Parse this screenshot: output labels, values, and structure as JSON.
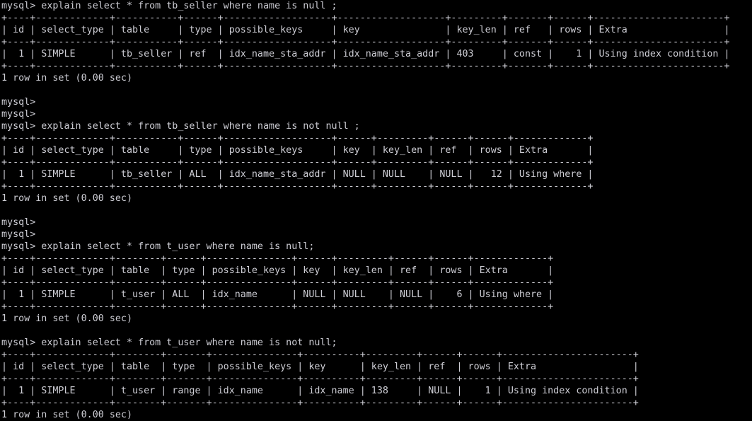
{
  "terminal": {
    "prompt": "mysql>",
    "background_color": "#000000",
    "text_color": "#cdcdd4",
    "font_size_px": 13.2,
    "line_height_px": 17,
    "columns": 132,
    "blocks": [
      {
        "id": "query-1",
        "command": "mysql> explain select * from tb_seller where name is null ;",
        "columns": [
          "id",
          "select_type",
          "table",
          "type",
          "possible_keys",
          "key",
          "key_len",
          "ref",
          "rows",
          "Extra"
        ],
        "rows": [
          {
            "id": "1",
            "select_type": "SIMPLE",
            "table": "tb_seller",
            "type": "ref",
            "possible_keys": "idx_name_sta_addr",
            "key": "idx_name_sta_addr",
            "key_len": "403",
            "ref": "const",
            "rows": "1",
            "Extra": "Using index condition"
          }
        ],
        "status": "1 row in set (0.00 sec)",
        "ascii": [
          "+----+-------------+-----------+------+-------------------+-------------------+---------+-------+------+-----------------------+",
          "| id | select_type | table     | type | possible_keys     | key               | key_len | ref   | rows | Extra                 |",
          "+----+-------------+-----------+------+-------------------+-------------------+---------+-------+------+-----------------------+",
          "|  1 | SIMPLE      | tb_seller | ref  | idx_name_sta_addr | idx_name_sta_addr | 403     | const |    1 | Using index condition |",
          "+----+-------------+-----------+------+-------------------+-------------------+---------+-------+------+-----------------------+"
        ]
      },
      {
        "id": "query-2",
        "command": "mysql> explain select * from tb_seller where name is not null ;",
        "columns": [
          "id",
          "select_type",
          "table",
          "type",
          "possible_keys",
          "key",
          "key_len",
          "ref",
          "rows",
          "Extra"
        ],
        "rows": [
          {
            "id": "1",
            "select_type": "SIMPLE",
            "table": "tb_seller",
            "type": "ALL",
            "possible_keys": "idx_name_sta_addr",
            "key": "NULL",
            "key_len": "NULL",
            "ref": "NULL",
            "rows": "12",
            "Extra": "Using where"
          }
        ],
        "status": "1 row in set (0.00 sec)",
        "ascii": [
          "+----+-------------+-----------+------+-------------------+------+---------+------+------+-------------+",
          "| id | select_type | table     | type | possible_keys     | key  | key_len | ref  | rows | Extra       |",
          "+----+-------------+-----------+------+-------------------+------+---------+------+------+-------------+",
          "|  1 | SIMPLE      | tb_seller | ALL  | idx_name_sta_addr | NULL | NULL    | NULL |   12 | Using where |",
          "+----+-------------+-----------+------+-------------------+------+---------+------+------+-------------+"
        ]
      },
      {
        "id": "query-3",
        "command": "mysql> explain select * from t_user where name is null;",
        "columns": [
          "id",
          "select_type",
          "table",
          "type",
          "possible_keys",
          "key",
          "key_len",
          "ref",
          "rows",
          "Extra"
        ],
        "rows": [
          {
            "id": "1",
            "select_type": "SIMPLE",
            "table": "t_user",
            "type": "ALL",
            "possible_keys": "idx_name",
            "key": "NULL",
            "key_len": "NULL",
            "ref": "NULL",
            "rows": "6",
            "Extra": "Using where"
          }
        ],
        "status": "1 row in set (0.00 sec)",
        "ascii": [
          "+----+-------------+--------+------+---------------+------+---------+------+------+-------------+",
          "| id | select_type | table  | type | possible_keys | key  | key_len | ref  | rows | Extra       |",
          "+----+-------------+--------+------+---------------+------+---------+------+------+-------------+",
          "|  1 | SIMPLE      | t_user | ALL  | idx_name      | NULL | NULL    | NULL |    6 | Using where |",
          "+----+-------------+--------+------+---------------+------+---------+------+------+-------------+"
        ]
      },
      {
        "id": "query-4",
        "command": "mysql> explain select * from t_user where name is not null;",
        "columns": [
          "id",
          "select_type",
          "table",
          "type",
          "possible_keys",
          "key",
          "key_len",
          "ref",
          "rows",
          "Extra"
        ],
        "rows": [
          {
            "id": "1",
            "select_type": "SIMPLE",
            "table": "t_user",
            "type": "range",
            "possible_keys": "idx_name",
            "key": "idx_name",
            "key_len": "138",
            "ref": "NULL",
            "rows": "1",
            "Extra": "Using index condition"
          }
        ],
        "status": "1 row in set (0.00 sec)",
        "ascii": [
          "+----+-------------+--------+-------+---------------+----------+---------+------+------+-----------------------+",
          "| id | select_type | table  | type  | possible_keys | key      | key_len | ref  | rows | Extra                 |",
          "+----+-------------+--------+-------+---------------+----------+---------+------+------+-----------------------+",
          "|  1 | SIMPLE      | t_user | range | idx_name      | idx_name | 138     | NULL |    1 | Using index condition |",
          "+----+-------------+--------+-------+---------------+----------+---------+------+------+-----------------------+"
        ]
      }
    ],
    "lines": [
      "mysql> explain select * from tb_seller where name is null ;",
      "+----+-------------+-----------+------+-------------------+-------------------+---------+-------+------+-----------------------+",
      "| id | select_type | table     | type | possible_keys     | key               | key_len | ref   | rows | Extra                 |",
      "+----+-------------+-----------+------+-------------------+-------------------+---------+-------+------+-----------------------+",
      "|  1 | SIMPLE      | tb_seller | ref  | idx_name_sta_addr | idx_name_sta_addr | 403     | const |    1 | Using index condition |",
      "+----+-------------+-----------+------+-------------------+-------------------+---------+-------+------+-----------------------+",
      "1 row in set (0.00 sec)",
      "",
      "mysql>",
      "mysql>",
      "mysql> explain select * from tb_seller where name is not null ;",
      "+----+-------------+-----------+------+-------------------+------+---------+------+------+-------------+",
      "| id | select_type | table     | type | possible_keys     | key  | key_len | ref  | rows | Extra       |",
      "+----+-------------+-----------+------+-------------------+------+---------+------+------+-------------+",
      "|  1 | SIMPLE      | tb_seller | ALL  | idx_name_sta_addr | NULL | NULL    | NULL |   12 | Using where |",
      "+----+-------------+-----------+------+-------------------+------+---------+------+------+-------------+",
      "1 row in set (0.00 sec)",
      "",
      "mysql>",
      "mysql>",
      "mysql> explain select * from t_user where name is null;",
      "+----+-------------+--------+------+---------------+------+---------+------+------+-------------+",
      "| id | select_type | table  | type | possible_keys | key  | key_len | ref  | rows | Extra       |",
      "+----+-------------+--------+------+---------------+------+---------+------+------+-------------+",
      "|  1 | SIMPLE      | t_user | ALL  | idx_name      | NULL | NULL    | NULL |    6 | Using where |",
      "+----+-------------+--------+------+---------------+------+---------+------+------+-------------+",
      "1 row in set (0.00 sec)",
      "",
      "mysql> explain select * from t_user where name is not null;",
      "+----+-------------+--------+-------+---------------+----------+---------+------+------+-----------------------+",
      "| id | select_type | table  | type  | possible_keys | key      | key_len | ref  | rows | Extra                 |",
      "+----+-------------+--------+-------+---------------+----------+---------+------+------+-----------------------+",
      "|  1 | SIMPLE      | t_user | range | idx_name      | idx_name | 138     | NULL |    1 | Using index condition |",
      "+----+-------------+--------+-------+---------------+----------+---------+------+------+-----------------------+",
      "1 row in set (0.00 sec)"
    ]
  }
}
